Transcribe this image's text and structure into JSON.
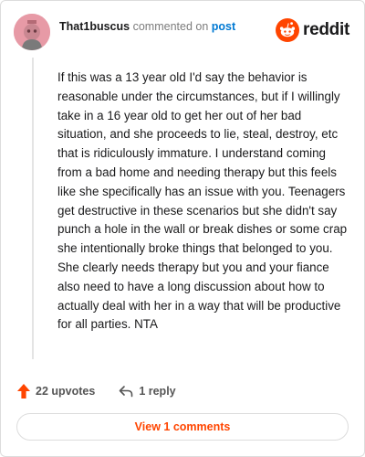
{
  "header": {
    "username": "That1buscus",
    "action_text": "commented on",
    "post_link": "post",
    "brand_name": "reddit"
  },
  "comment": {
    "text": "If this was a 13 year old I'd say the behavior is reasonable under the circumstances, but if I willingly take in a 16 year old to get her out of her bad situation, and she proceeds to lie, steal, destroy, etc that is ridiculously immature. I understand coming from a bad home and needing therapy but this feels like she specifically has an issue with you. Teenagers get destructive in these scenarios but she didn't say punch a hole in the wall or break dishes or some crap she intentionally broke things that belonged to you. She clearly needs therapy but you and your fiance also need to have a long discussion about how to actually deal with her in a way that will be productive for all parties. NTA"
  },
  "footer": {
    "upvotes": "22 upvotes",
    "replies": "1 reply",
    "view_comments": "View 1 comments"
  },
  "icons": {
    "upvote": "upvote-arrow-icon",
    "reply": "reply-arrow-icon",
    "brand": "reddit-snoo-icon",
    "avatar": "snoo-avatar-icon"
  },
  "colors": {
    "accent": "#ff4500",
    "link": "#0079d3",
    "avatar_bg": "#e79aa6"
  }
}
